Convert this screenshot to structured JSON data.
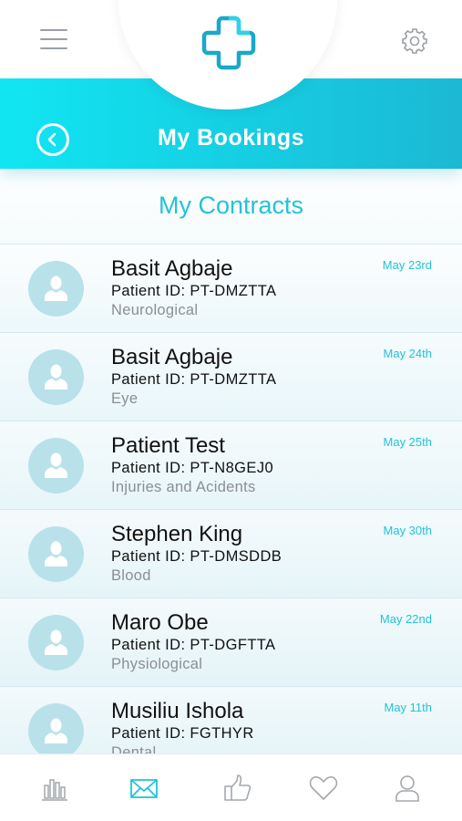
{
  "header": {
    "title": "My Bookings",
    "accent_color": "#16cde2",
    "icons": [
      "menu-icon",
      "medical-cross-logo-icon",
      "gear-icon",
      "back-arrow-icon"
    ]
  },
  "section": {
    "title": "My Contracts"
  },
  "contracts": [
    {
      "name": "Basit Agbaje",
      "patient_id": "Patient ID: PT-DMZTTA",
      "category": "Neurological",
      "date": "May 23rd"
    },
    {
      "name": "Basit Agbaje",
      "patient_id": "Patient ID: PT-DMZTTA",
      "category": "Eye",
      "date": "May 24th"
    },
    {
      "name": "Patient Test",
      "patient_id": "Patient ID: PT-N8GEJ0",
      "category": "Injuries and Acidents",
      "date": "May 25th"
    },
    {
      "name": "Stephen King",
      "patient_id": "Patient ID: PT-DMSDDB",
      "category": "Blood",
      "date": "May 30th"
    },
    {
      "name": "Maro Obe",
      "patient_id": "Patient ID: PT-DGFTTA",
      "category": "Physiological",
      "date": "May 22nd"
    },
    {
      "name": "Musiliu Ishola",
      "patient_id": "Patient ID: FGTHYR",
      "category": "Dental",
      "date": "May 11th"
    }
  ],
  "tabs": [
    {
      "icon": "bar-chart-icon",
      "active": false
    },
    {
      "icon": "envelope-icon",
      "active": true
    },
    {
      "icon": "thumbs-up-icon",
      "active": false
    },
    {
      "icon": "heart-icon",
      "active": false
    },
    {
      "icon": "user-icon",
      "active": false
    }
  ]
}
